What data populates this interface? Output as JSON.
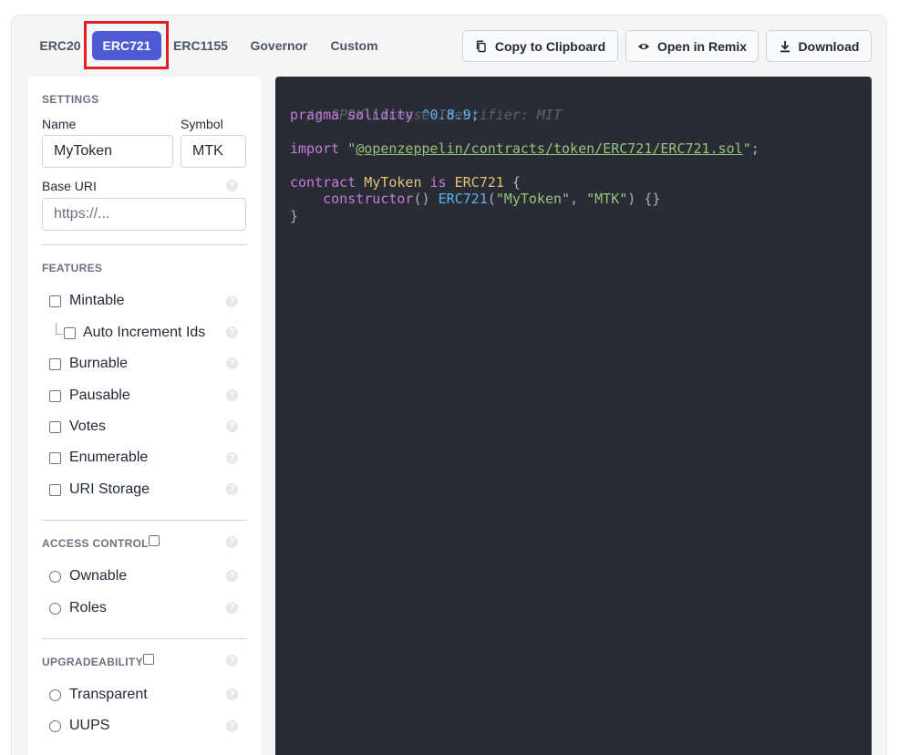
{
  "tabs": [
    {
      "label": "ERC20",
      "active": false
    },
    {
      "label": "ERC721",
      "active": true
    },
    {
      "label": "ERC1155",
      "active": false
    },
    {
      "label": "Governor",
      "active": false
    },
    {
      "label": "Custom",
      "active": false
    }
  ],
  "actions": {
    "copy": {
      "label": "Copy to Clipboard",
      "icon": "copy-icon"
    },
    "remix": {
      "label": "Open in Remix",
      "icon": "remix-icon"
    },
    "download": {
      "label": "Download",
      "icon": "download-icon"
    }
  },
  "settings": {
    "title": "SETTINGS",
    "name_label": "Name",
    "name_value": "MyToken",
    "symbol_label": "Symbol",
    "symbol_value": "MTK",
    "base_uri_label": "Base URI",
    "base_uri_placeholder": "https://..."
  },
  "features": {
    "title": "FEATURES",
    "items": [
      {
        "label": "Mintable",
        "checked": false
      },
      {
        "label": "Auto Increment Ids",
        "checked": false
      },
      {
        "label": "Burnable",
        "checked": false
      },
      {
        "label": "Pausable",
        "checked": false
      },
      {
        "label": "Votes",
        "checked": false
      },
      {
        "label": "Enumerable",
        "checked": false
      },
      {
        "label": "URI Storage",
        "checked": false
      }
    ]
  },
  "access_control": {
    "title": "ACCESS CONTROL",
    "options": [
      {
        "label": "Ownable",
        "selected": false
      },
      {
        "label": "Roles",
        "selected": false
      }
    ]
  },
  "upgradeability": {
    "title": "UPGRADEABILITY",
    "options": [
      {
        "label": "Transparent",
        "selected": false
      },
      {
        "label": "UUPS",
        "selected": false
      }
    ]
  },
  "help_glyph": "?",
  "code": {
    "comment": "// SPDX-License-Identifier: MIT",
    "pragma_kw": "pragma solidity",
    "pragma_ver": "^0.8.9",
    "semicolon": ";",
    "import_kw": "import",
    "import_path": "@openzeppelin/contracts/token/ERC721/ERC721.sol",
    "quote": "\"",
    "contract_kw": "contract",
    "contract_name": "MyToken",
    "is_kw": "is",
    "base": "ERC721",
    "open_brace": " {",
    "indent": "    ",
    "constructor_kw": "constructor",
    "parens": "()",
    "ctor_call": "ERC721",
    "open_paren": "(",
    "arg1": "\"MyToken\"",
    "comma": ", ",
    "arg2": "\"MTK\"",
    "close_tail": ") {}",
    "close_brace": "}"
  },
  "colors": {
    "active_tab": "#4f5bd5",
    "highlight": "#e02020",
    "code_bg": "#282c34"
  }
}
